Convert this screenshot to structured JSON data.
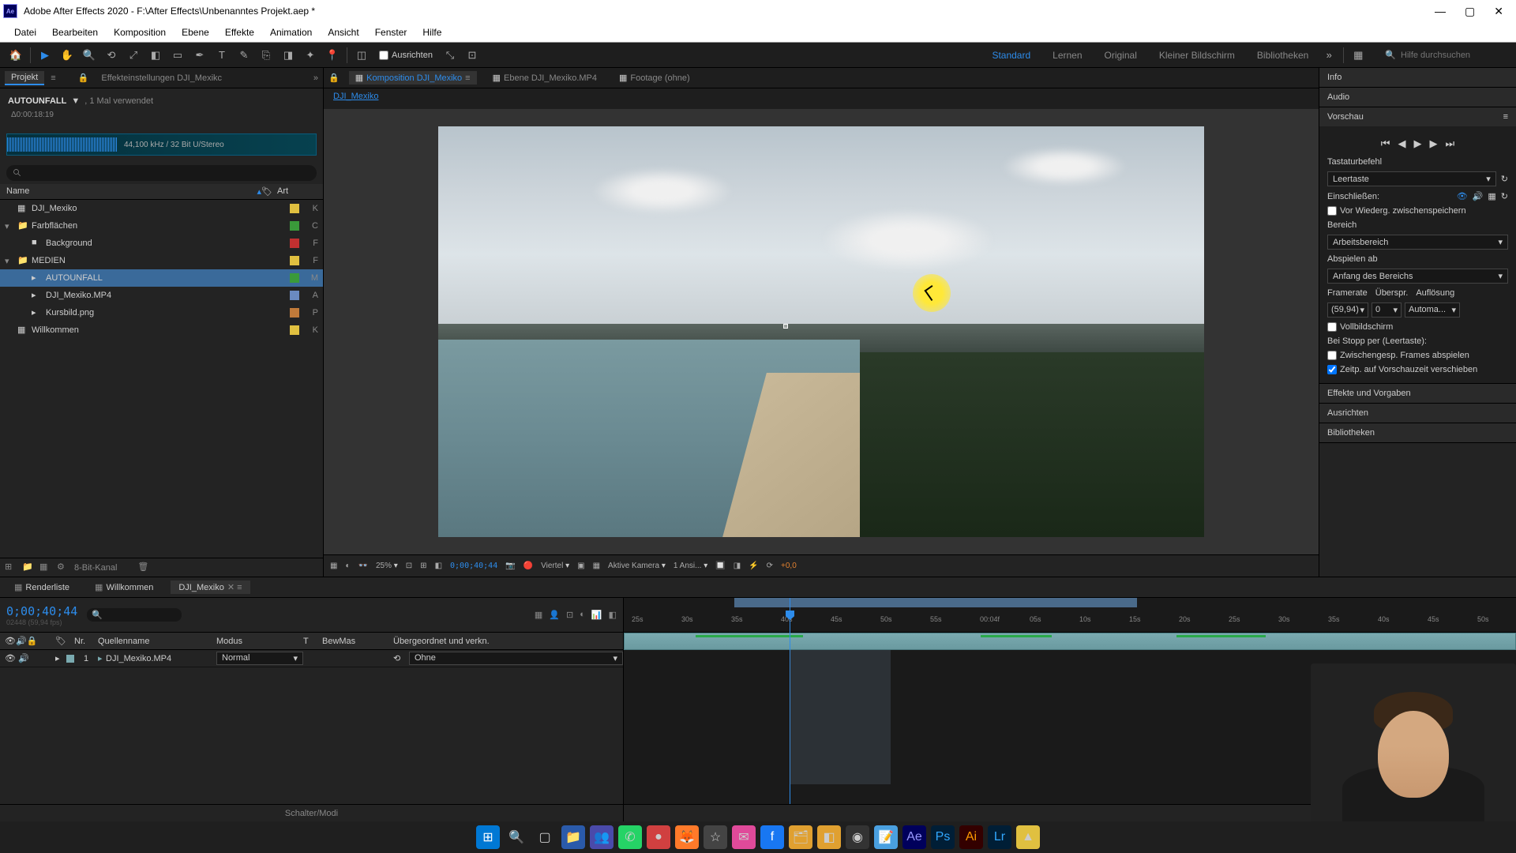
{
  "app": {
    "title": "Adobe After Effects 2020 - F:\\After Effects\\Unbenanntes Projekt.aep *",
    "logo": "Ae"
  },
  "menu": [
    "Datei",
    "Bearbeiten",
    "Komposition",
    "Ebene",
    "Effekte",
    "Animation",
    "Ansicht",
    "Fenster",
    "Hilfe"
  ],
  "toolbar": {
    "snapping": "Ausrichten",
    "workspaces": {
      "items": [
        "Standard",
        "Lernen",
        "Original",
        "Kleiner Bildschirm",
        "Bibliotheken"
      ],
      "active": "Standard"
    },
    "search_placeholder": "Hilfe durchsuchen"
  },
  "project": {
    "tab": "Projekt",
    "effects_tab": "Effekteinstellungen  DJI_Mexikc",
    "asset_name": "AUTOUNFALL",
    "asset_dropdown": "▼",
    "asset_usage": ", 1 Mal verwendet",
    "asset_duration": "Δ0:00:18:19",
    "audio_info": "44,100 kHz / 32 Bit U/Stereo",
    "cols": {
      "name": "Name",
      "type": "Art"
    },
    "items": [
      {
        "name": "DJI_Mexiko",
        "kind": "comp",
        "color": "#e0c040",
        "type": "K",
        "indent": 0,
        "arrow": ""
      },
      {
        "name": "Farbflächen",
        "kind": "folder",
        "color": "#3a9a3a",
        "type": "C",
        "indent": 0,
        "arrow": "▾"
      },
      {
        "name": "Background",
        "kind": "solid",
        "color": "#c03030",
        "type": "F",
        "indent": 1,
        "arrow": ""
      },
      {
        "name": "MEDIEN",
        "kind": "folder",
        "color": "#e0c040",
        "type": "F",
        "indent": 0,
        "arrow": "▾",
        "open": true
      },
      {
        "name": "AUTOUNFALL",
        "kind": "audio",
        "color": "#3a9a3a",
        "type": "M",
        "indent": 1,
        "arrow": "",
        "selected": true
      },
      {
        "name": "DJI_Mexiko.MP4",
        "kind": "video",
        "color": "#6a8ac0",
        "type": "A",
        "indent": 1,
        "arrow": ""
      },
      {
        "name": "Kursbild.png",
        "kind": "image",
        "color": "#c07a3a",
        "type": "P",
        "indent": 1,
        "arrow": ""
      },
      {
        "name": "Willkommen",
        "kind": "comp",
        "color": "#e0c040",
        "type": "K",
        "indent": 0,
        "arrow": ""
      }
    ],
    "footer_depth": "8-Bit-Kanal"
  },
  "comp": {
    "tabs": [
      {
        "label": "Komposition",
        "link": "DJI_Mexiko",
        "active": true
      },
      {
        "label": "Ebene DJI_Mexiko.MP4"
      },
      {
        "label": "Footage (ohne)"
      }
    ],
    "flow": "DJI_Mexiko",
    "footer": {
      "zoom": "25%",
      "timecode": "0;00;40;44",
      "res": "Viertel",
      "camera": "Aktive Kamera",
      "views": "1 Ansi...",
      "offset": "+0,0"
    }
  },
  "right": {
    "info": "Info",
    "audio": "Audio",
    "preview": {
      "title": "Vorschau",
      "shortcut_label": "Tastaturbefehl",
      "shortcut": "Leertaste",
      "include": "Einschließen:",
      "cache": "Vor Wiederg. zwischenspeichern",
      "range_label": "Bereich",
      "range": "Arbeitsbereich",
      "playfrom_label": "Abspielen ab",
      "playfrom": "Anfang des Bereichs",
      "framerate_label": "Framerate",
      "skip_label": "Überspr.",
      "res_label": "Auflösung",
      "framerate": "(59,94)",
      "skip": "0",
      "res": "Automa...",
      "fullscreen": "Vollbildschirm",
      "onstop": "Bei Stopp per (Leertaste):",
      "cachedframes": "Zwischengesp. Frames abspielen",
      "movetime": "Zeitp. auf Vorschauzeit verschieben"
    },
    "effects": "Effekte und Vorgaben",
    "align": "Ausrichten",
    "libs": "Bibliotheken"
  },
  "timeline": {
    "tabs": [
      {
        "label": "Renderliste"
      },
      {
        "label": "Willkommen"
      },
      {
        "label": "DJI_Mexiko",
        "active": true
      }
    ],
    "timecode": "0;00;40;44",
    "timecode_sub": "02448 (59,94 fps)",
    "cols": {
      "num": "Nr.",
      "source": "Quellenname",
      "mode": "Modus",
      "t": "T",
      "trkmat": "BewMas",
      "parent": "Übergeordnet und verkn."
    },
    "layer": {
      "num": "1",
      "name": "DJI_Mexiko.MP4",
      "mode": "Normal",
      "parent": "Ohne",
      "color": "#7aaab0"
    },
    "ticks": [
      "25s",
      "30s",
      "35s",
      "40s",
      "45s",
      "50s",
      "55s",
      "00:04f",
      "05s",
      "10s",
      "15s",
      "20s",
      "25s",
      "30s",
      "35s",
      "40s",
      "45s",
      "50s"
    ],
    "footer": "Schalter/Modi"
  },
  "taskbar": {
    "icons": [
      {
        "name": "start",
        "glyph": "⊞",
        "bg": "#0078d4",
        "fg": "#fff"
      },
      {
        "name": "search",
        "glyph": "🔍",
        "bg": "transparent"
      },
      {
        "name": "taskview",
        "glyph": "▢",
        "bg": "transparent"
      },
      {
        "name": "explorer",
        "glyph": "📁",
        "bg": "#2a5aaa"
      },
      {
        "name": "teams",
        "glyph": "👥",
        "bg": "#4a4aaa"
      },
      {
        "name": "whatsapp",
        "glyph": "✆",
        "bg": "#25d366"
      },
      {
        "name": "app1",
        "glyph": "●",
        "bg": "#d04040"
      },
      {
        "name": "firefox",
        "glyph": "🦊",
        "bg": "#ff7a2a"
      },
      {
        "name": "app2",
        "glyph": "☆",
        "bg": "#444"
      },
      {
        "name": "messenger",
        "glyph": "✉",
        "bg": "#e04a9a"
      },
      {
        "name": "facebook",
        "glyph": "f",
        "bg": "#1877f2",
        "fg": "#fff"
      },
      {
        "name": "files",
        "glyph": "🗂",
        "bg": "#e0a030"
      },
      {
        "name": "app3",
        "glyph": "◧",
        "bg": "#e0a030"
      },
      {
        "name": "obs",
        "glyph": "◉",
        "bg": "#333"
      },
      {
        "name": "notepad",
        "glyph": "📝",
        "bg": "#4aa0e0"
      },
      {
        "name": "ae",
        "glyph": "Ae",
        "bg": "#00005b",
        "fg": "#9999ff"
      },
      {
        "name": "ps",
        "glyph": "Ps",
        "bg": "#001e36",
        "fg": "#31a8ff"
      },
      {
        "name": "ai",
        "glyph": "Ai",
        "bg": "#330000",
        "fg": "#ff9a00"
      },
      {
        "name": "lr",
        "glyph": "Lr",
        "bg": "#001e36",
        "fg": "#31a8ff"
      },
      {
        "name": "app4",
        "glyph": "▲",
        "bg": "#e0c040"
      }
    ]
  }
}
